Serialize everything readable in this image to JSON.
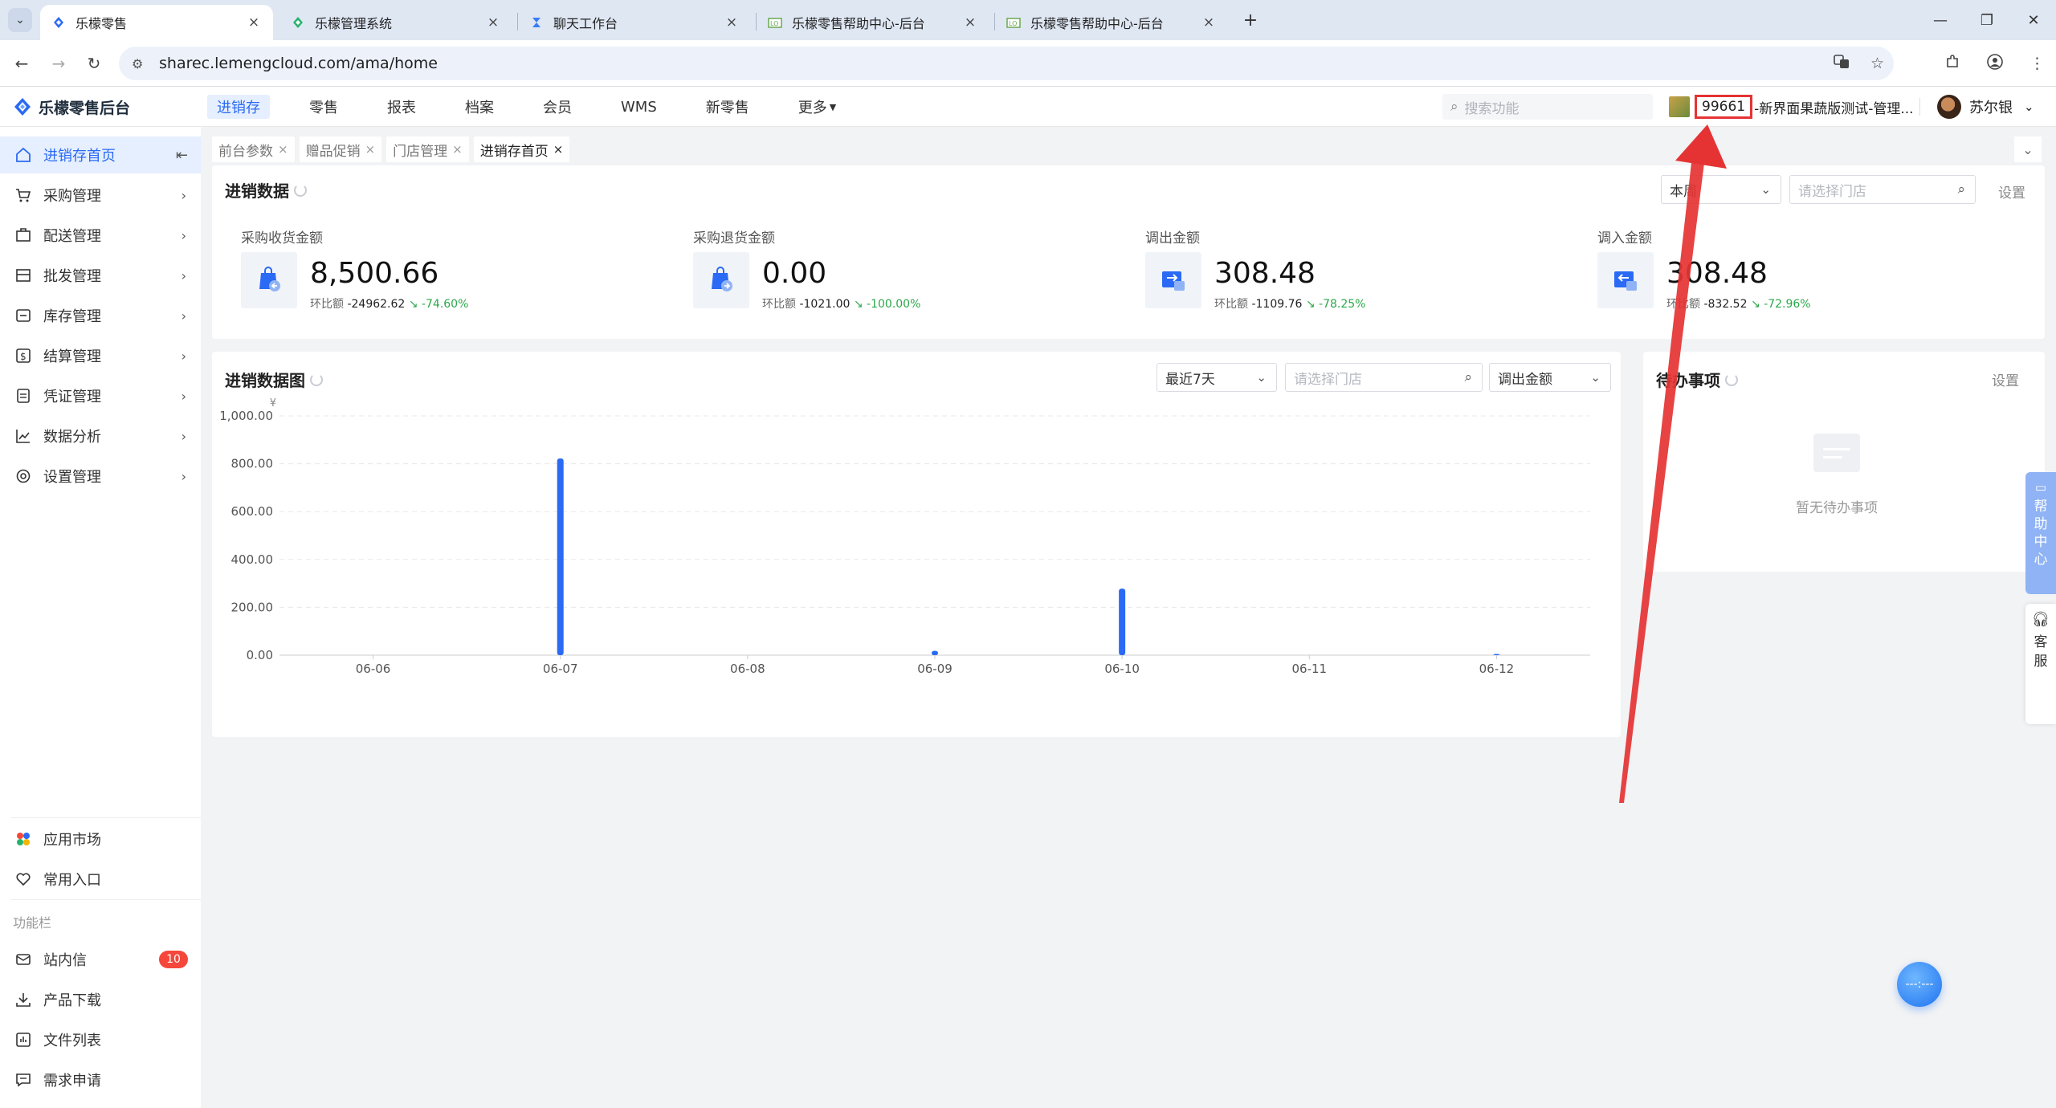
{
  "browser": {
    "tabs": [
      {
        "title": "乐檬零售",
        "active": true
      },
      {
        "title": "乐檬管理系统",
        "active": false
      },
      {
        "title": "聊天工作台",
        "active": false
      },
      {
        "title": "乐檬零售帮助中心-后台",
        "active": false
      },
      {
        "title": "乐檬零售帮助中心-后台",
        "active": false
      }
    ],
    "url": "sharec.lemengcloud.com/ama/home"
  },
  "header": {
    "logo": "乐檬零售后台",
    "nav": [
      "进销存",
      "零售",
      "报表",
      "档案",
      "会员",
      "WMS",
      "新零售",
      "更多"
    ],
    "search_placeholder": "搜索功能",
    "store_code": "99661",
    "store_name": "-新界面果蔬版测试-管理...",
    "user_name": "苏尔银"
  },
  "sidebar": {
    "items": [
      "进销存首页",
      "采购管理",
      "配送管理",
      "批发管理",
      "库存管理",
      "结算管理",
      "凭证管理",
      "数据分析",
      "设置管理"
    ],
    "bottom": [
      "应用市场",
      "常用入口"
    ],
    "section_label": "功能栏",
    "tools": [
      "站内信",
      "产品下载",
      "文件列表",
      "需求申请"
    ],
    "message_badge": "10"
  },
  "page_tabs": [
    "前台参数",
    "赠品促销",
    "门店管理",
    "进销存首页"
  ],
  "summary": {
    "title": "进销数据",
    "period": "本周",
    "store_placeholder": "请选择门店",
    "settings": "设置",
    "stats": [
      {
        "label": "采购收货金额",
        "value": "8,500.66",
        "cmp_label": "环比额",
        "diff": "-24962.62",
        "pct": "-74.60%"
      },
      {
        "label": "采购退货金额",
        "value": "0.00",
        "cmp_label": "环比额",
        "diff": "-1021.00",
        "pct": "-100.00%"
      },
      {
        "label": "调出金额",
        "value": "308.48",
        "cmp_label": "环比额",
        "diff": "-1109.76",
        "pct": "-78.25%"
      },
      {
        "label": "调入金额",
        "value": "308.48",
        "cmp_label": "环比额",
        "diff": "-832.52",
        "pct": "-72.96%"
      }
    ]
  },
  "chart_panel": {
    "title": "进销数据图",
    "range": "最近7天",
    "store_placeholder": "请选择门店",
    "metric": "调出金额"
  },
  "chart_data": {
    "type": "bar",
    "title": "",
    "xlabel": "",
    "ylabel": "¥",
    "categories": [
      "06-06",
      "06-07",
      "06-08",
      "06-09",
      "06-10",
      "06-11",
      "06-12"
    ],
    "values": [
      0,
      822,
      0,
      18,
      278,
      0,
      5
    ],
    "ylim": [
      0,
      1000
    ],
    "yticks": [
      "0.00",
      "200.00",
      "400.00",
      "600.00",
      "800.00",
      "1,000.00"
    ],
    "grid": true,
    "color": "#2a6af4"
  },
  "todo": {
    "title": "待办事项",
    "settings": "设置",
    "empty": "暂无待办事项"
  },
  "floating": {
    "help": [
      "帮",
      "助",
      "中",
      "心"
    ],
    "service": [
      "客",
      "服"
    ],
    "ball": "---:---"
  },
  "colors": {
    "primary": "#2a6af4",
    "annotation": "#e53333",
    "positive_change": "#2ba84a"
  }
}
